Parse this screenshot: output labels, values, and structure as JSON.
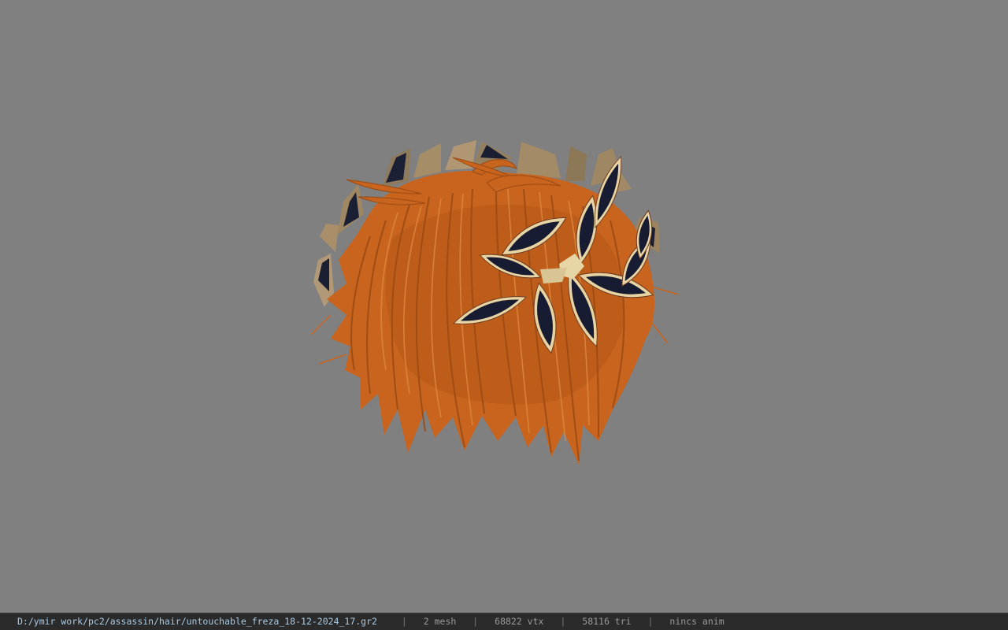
{
  "viewport": {
    "background_color": "#808080",
    "model": {
      "subject": "orange spiky hair mesh with dark-petal flower wreath",
      "hair_color": "#c8641e",
      "hair_dark": "#9a4a14",
      "hair_light": "#e08a3e",
      "petal_fill": "#171c33",
      "petal_rim": "#e8d4a2",
      "petal_edge": "#6b3a22",
      "leaf_color": "#a08866"
    }
  },
  "status_bar": {
    "file_path": "D:/ymir work/pc2/assassin/hair/untouchable_freza_18-12-2024_17.gr2",
    "mesh_count": "2 mesh",
    "vertex_count": "68822 vtx",
    "triangle_count": "58116 tri",
    "anim_status": "nincs anim",
    "separator": "|",
    "path_color": "#a9cbe6",
    "text_color": "#9a9a9a",
    "background": "#2b2b2b"
  }
}
